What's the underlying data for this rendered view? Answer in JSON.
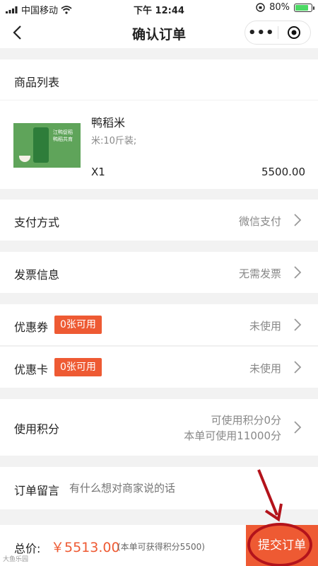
{
  "status_bar": {
    "carrier": "中国移动",
    "time": "下午 12:44",
    "battery": "80%",
    "battery_level": 0.8
  },
  "nav": {
    "title": "确认订单"
  },
  "products": {
    "header": "商品列表",
    "item": {
      "name": "鸭稻米",
      "spec": "米:10斤装;",
      "qty": "X1",
      "price": "5500.00",
      "image_text": [
        "江鸭促稻",
        "鸭稻共育"
      ]
    }
  },
  "payment": {
    "label": "支付方式",
    "value": "微信支付"
  },
  "invoice": {
    "label": "发票信息",
    "value": "无需发票"
  },
  "coupon": {
    "label": "优惠券",
    "badge": "0张可用",
    "value": "未使用"
  },
  "card": {
    "label": "优惠卡",
    "badge": "0张可用",
    "value": "未使用"
  },
  "points": {
    "label": "使用积分",
    "line1": "可使用积分0分",
    "line2": "本单可使用11000分"
  },
  "remark": {
    "label": "订单留言",
    "placeholder": "有什么想对商家说的话"
  },
  "footer": {
    "total_label": "总价:",
    "total_price": "￥5513.00",
    "points_note": "(本单可获得积分5500)",
    "submit_label": "提交订单"
  },
  "watermark": "大鱼乐园",
  "colors": {
    "accent": "#ee5a33",
    "annotation": "#b3131b"
  }
}
